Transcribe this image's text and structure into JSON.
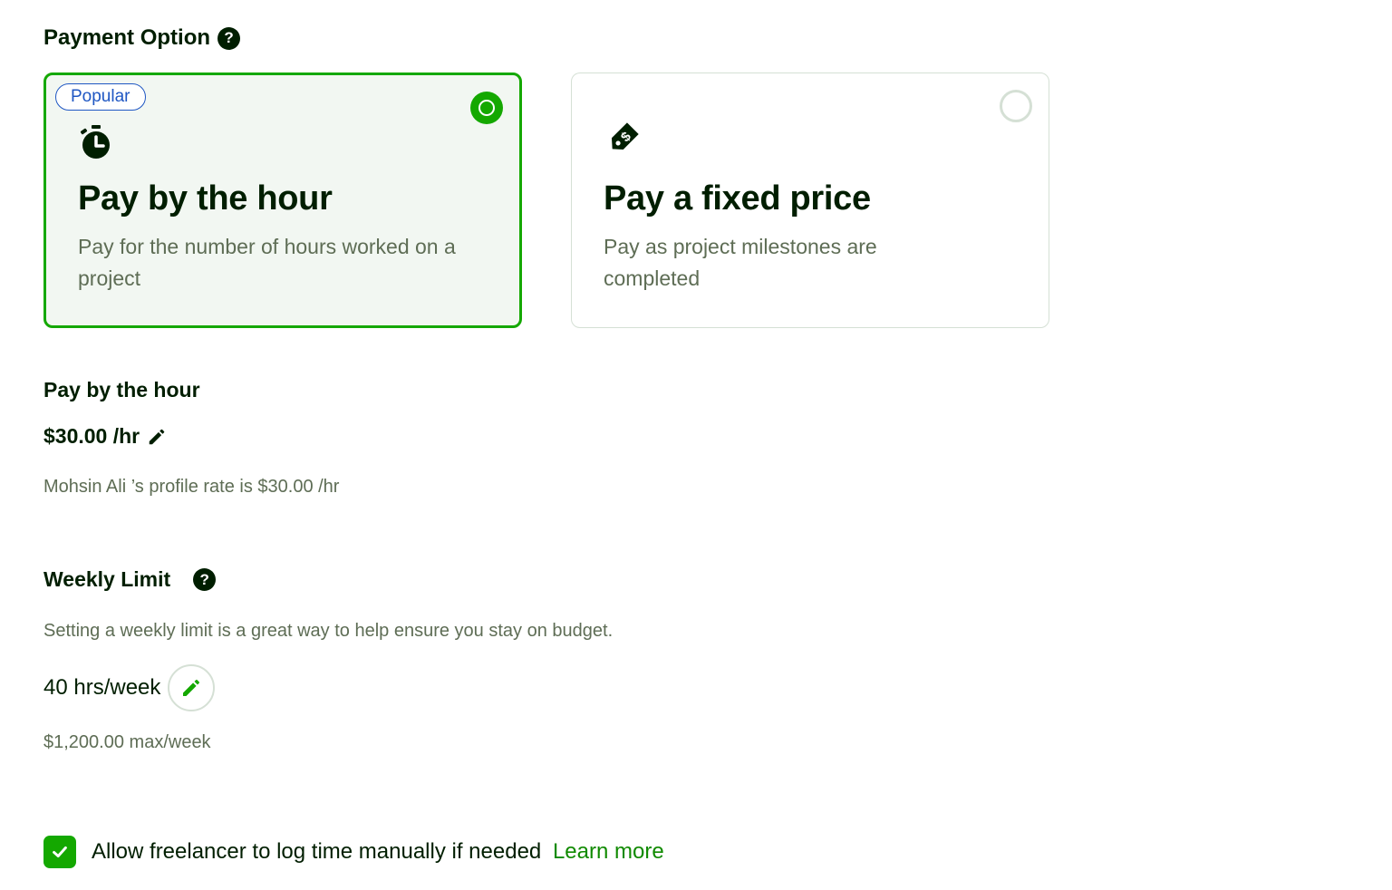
{
  "payment": {
    "title": "Payment Option",
    "help_glyph": "?",
    "options": [
      {
        "badge": "Popular",
        "icon": "stopwatch-icon",
        "title": "Pay by the hour",
        "description": "Pay for the number of hours worked on a project",
        "selected": true
      },
      {
        "icon": "price-tag-icon",
        "title": "Pay a fixed price",
        "description": "Pay as project milestones are completed",
        "selected": false
      }
    ]
  },
  "hourly": {
    "title": "Pay by the hour",
    "rate": "$30.00 /hr",
    "profile_rate_note": "Mohsin Ali ’s profile rate is $30.00 /hr"
  },
  "weekly_limit": {
    "title": "Weekly Limit",
    "help_glyph": "?",
    "description": "Setting a weekly limit is a great way to help ensure you stay on budget.",
    "hours": "40 hrs/week",
    "max_amount": "$1,200.00 max/week"
  },
  "manual_time": {
    "checked": true,
    "label": "Allow freelancer to log time manually if needed",
    "link": "Learn more"
  },
  "colors": {
    "accent_green": "#14a800",
    "link_green": "#108a00",
    "badge_blue": "#1f57c3",
    "text_dark": "#001e00",
    "text_muted": "#5e6d55"
  }
}
